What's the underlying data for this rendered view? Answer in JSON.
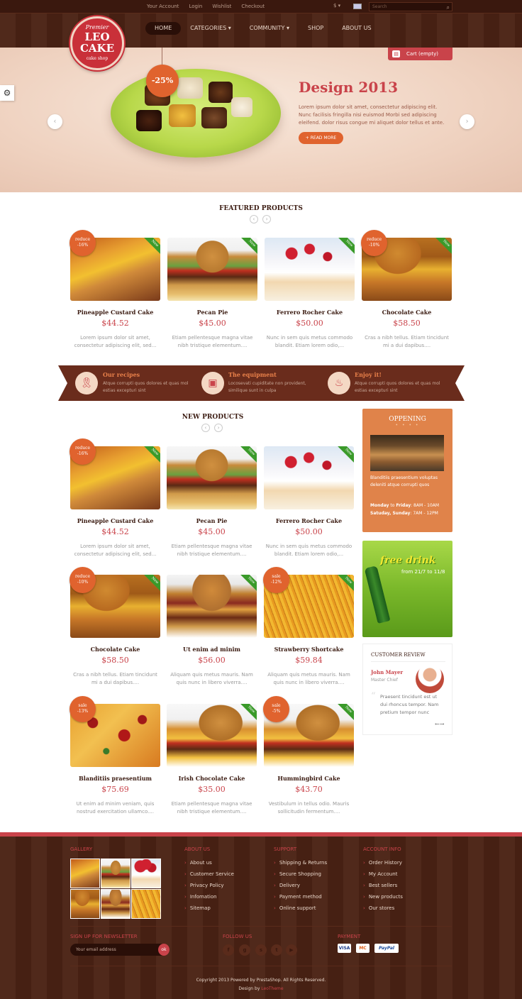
{
  "topbar": {
    "links": [
      "Your Account",
      "Login",
      "Wishlist",
      "Checkout"
    ],
    "currency": "$ ▾",
    "search_placeholder": "Search"
  },
  "logo": {
    "premier": "Premier",
    "name_line1": "LEO",
    "name_line2": "CAKE",
    "tagline": "cake shop"
  },
  "nav": [
    {
      "label": "HOME",
      "active": true
    },
    {
      "label": "CATEGORIES ▾"
    },
    {
      "label": "COMMUNITY ▾"
    },
    {
      "label": "SHOP"
    },
    {
      "label": "ABOUT US"
    }
  ],
  "cart": {
    "label": "Cart (empty)"
  },
  "slider": {
    "badge": "-25%",
    "title": "Design 2013",
    "text": "Lorem ipsum dolor sit amet, consectetur adipiscing elit. Nunc facilisis fringilla nisi euismod Morbi sed adipiscing eleifend. dolor risus congue mi aliquet dolor tellus et ante.",
    "button": "+ READ MORE"
  },
  "featured": {
    "title": "FEATURED PRODUCTS",
    "products": [
      {
        "name": "Pineapple Custard Cake",
        "price": "$44.52",
        "desc": "Lorem ipsum dolor sit amet, consectetur adipiscing elit, sed...",
        "badge_l1": "reduce",
        "badge_l2": "-16%",
        "new": true
      },
      {
        "name": "Pecan Pie",
        "price": "$45.00",
        "desc": "Etiam pellentesque magna vitae nibh tristique elementum....",
        "new": true
      },
      {
        "name": "Ferrero Rocher Cake",
        "price": "$50.00",
        "desc": "Nunc in sem quis metus commodo blandit. Etiam lorem odio,...",
        "new": true
      },
      {
        "name": "Chocolate Cake",
        "price": "$58.50",
        "desc": "Cras a nibh tellus. Etiam tincidunt mi a dui dapibus....",
        "badge_l1": "reduce",
        "badge_l2": "-10%",
        "new": true
      }
    ]
  },
  "banner": [
    {
      "title": "Our recipes",
      "text": "Atque corrupti quos dolores et quas mol estias excepturi sint",
      "icon": "ribbon-icon"
    },
    {
      "title": "The equipment",
      "text": "Locosevati cupiditate non provident, similique sunt in culpa",
      "icon": "oven-icon"
    },
    {
      "title": "Enjoy it!",
      "text": "Atque corrupti quos dolores et quas mol estias excepturi sint",
      "icon": "cupcake-icon"
    }
  ],
  "new_products": {
    "title": "NEW PRODUCTS",
    "products": [
      {
        "name": "Pineapple Custard Cake",
        "price": "$44.52",
        "desc": "Lorem ipsum dolor sit amet, consectetur adipiscing elit, sed...",
        "badge_l1": "reduce",
        "badge_l2": "-16%",
        "new": true
      },
      {
        "name": "Pecan Pie",
        "price": "$45.00",
        "desc": "Etiam pellentesque magna vitae nibh tristique elementum....",
        "new": true
      },
      {
        "name": "Ferrero Rocher Cake",
        "price": "$50.00",
        "desc": "Nunc in sem quis metus commodo blandit. Etiam lorem odio,...",
        "new": true
      },
      {
        "name": "Chocolate Cake",
        "price": "$58.50",
        "desc": "Cras a nibh tellus. Etiam tincidunt mi a dui dapibus....",
        "badge_l1": "reduce",
        "badge_l2": "-10%",
        "new": true
      },
      {
        "name": "Ut enim ad minim",
        "price": "$56.00",
        "desc": "Aliquam quis metus mauris. Nam quis nunc in libero viverra....",
        "new": true
      },
      {
        "name": "Strawberry Shortcake",
        "price": "$59.84",
        "desc": "Aliquam quis metus mauris. Nam quis nunc in libero viverra....",
        "badge_l1": "sale",
        "badge_l2": "-12%",
        "new": true
      },
      {
        "name": "Blanditiis praesentium",
        "price": "$75.69",
        "desc": "Ut enim ad minim veniam, quis nostrud exercitation ullamco....",
        "badge_l1": "sale",
        "badge_l2": "-13%"
      },
      {
        "name": "Irish Chocolate Cake",
        "price": "$35.00",
        "desc": "Etiam pellentesque magna vitae nibh tristique elementum....",
        "new": true
      },
      {
        "name": "Hummingbird Cake",
        "price": "$43.70",
        "desc": "Vestibulum in tellus odio. Mauris sollicitudin fermentum....",
        "badge_l1": "sale",
        "badge_l2": "-5%",
        "new": true
      }
    ]
  },
  "ribbon_label": "New",
  "sidebar": {
    "opening": {
      "title": "OPPENING",
      "text": "Blanditiis praesentium voluptas deleniti atque corrupti quos",
      "hours1_day": "Monday",
      "hours1_to": "to",
      "hours1_day2": "Friday",
      "hours1_time": ": 8AM - 10AM",
      "hours2_day": "Satuday, Sunday",
      "hours2_time": ": 7AM - 12PM"
    },
    "drink": {
      "title": "free drink",
      "dates": "from 21/7 to 11/8"
    },
    "review": {
      "title": "CUSTOMER REVIEW",
      "name": "John Mayer",
      "role": "Master Chief",
      "text": "Praesent tincidunt est ut dui rhoncus tempor. Nam pretium tempor nunc"
    }
  },
  "footer": {
    "gallery_title": "GALLERY",
    "about_title": "ABOUT US",
    "about_links": [
      "About us",
      "Customer Service",
      "Privacy Policy",
      "Infomation",
      "Sitemap"
    ],
    "support_title": "SUPPORT",
    "support_links": [
      "Shipping & Returns",
      "Secure Shopping",
      "Delivery",
      "Payment method",
      "Online support"
    ],
    "account_title": "ACCOUNT INFO",
    "account_links": [
      "Order History",
      "My Account",
      "Best sellers",
      "New products",
      "Our stores"
    ],
    "newsletter_title": "SIGN UP FOR NEWSLETTER",
    "newsletter_placeholder": "Your email address",
    "newsletter_button": "ok",
    "follow_title": "FOLLOW US",
    "social_icons": [
      "facebook-icon",
      "google-plus-icon",
      "skype-icon",
      "twitter-icon",
      "youtube-icon"
    ],
    "payment_title": "PAYMENT",
    "payment_methods": [
      "VISA",
      "MC",
      "PayPal"
    ],
    "copyright": "Copyright 2013 Powered by PrestaShop. All Rights Reserved.",
    "design_by": "Design by",
    "designer": "LeoTheme"
  },
  "colors": {
    "accent": "#c9434a",
    "orange": "#e0632e",
    "brown": "#4a2214",
    "new_ribbon": "#3a9a2a"
  }
}
